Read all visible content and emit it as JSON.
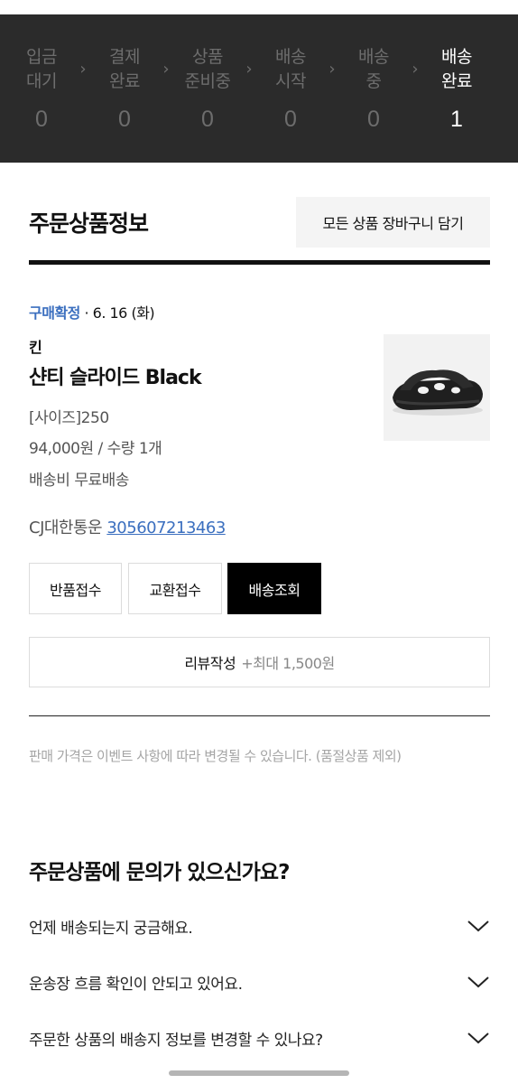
{
  "delivery_steps": [
    {
      "label": "입금\n대기",
      "count": "0",
      "active": false
    },
    {
      "label": "결제\n완료",
      "count": "0",
      "active": false
    },
    {
      "label": "상품\n준비중",
      "count": "0",
      "active": false
    },
    {
      "label": "배송\n시작",
      "count": "0",
      "active": false
    },
    {
      "label": "배송\n중",
      "count": "0",
      "active": false
    },
    {
      "label": "배송\n완료",
      "count": "1",
      "active": true
    }
  ],
  "section": {
    "title": "주문상품정보",
    "cart_all_label": "모든 상품 장바구니 담기"
  },
  "order": {
    "status": "구매확정",
    "date": " · 6. 16 (화)",
    "brand": "킨",
    "product_name": "샨티 슬라이드 Black",
    "option": "[사이즈]250",
    "price_qty": "94,000원 / 수량 1개",
    "shipping": "배송비 무료배송",
    "courier": "CJ대한통운 ",
    "tracking_number": "305607213463",
    "image_icon": "slide-sandal-image"
  },
  "actions": {
    "return_label": "반품접수",
    "exchange_label": "교환접수",
    "tracking_label": "배송조회",
    "review_label": "리뷰작성",
    "review_reward": "+최대 1,500원"
  },
  "notice": "판매 가격은 이벤트 사항에 따라 변경될 수 있습니다. (품절상품 제외)",
  "faq": {
    "title": "주문상품에 문의가 있으신가요?",
    "items": [
      "언제 배송되는지 궁금해요.",
      "운송장 흐름 확인이 안되고 있어요.",
      "주문한 상품의 배송지 정보를 변경할 수 있나요?"
    ]
  },
  "colors": {
    "accent_blue": "#3b6fbf",
    "status_panel": "#2b2b2b"
  }
}
